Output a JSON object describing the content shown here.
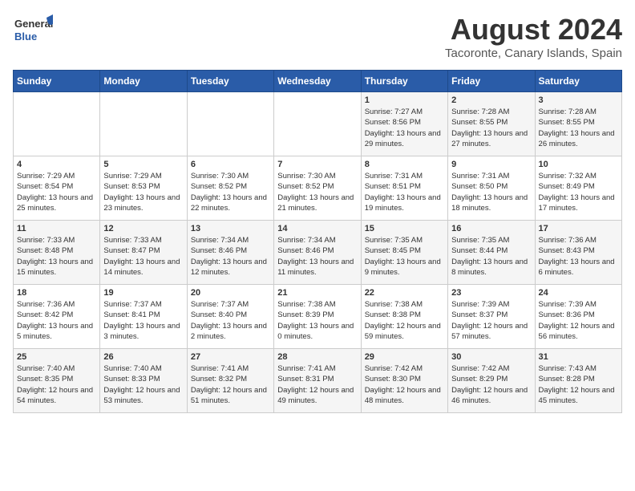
{
  "logo": {
    "general": "General",
    "blue": "Blue"
  },
  "title": "August 2024",
  "subtitle": "Tacoronte, Canary Islands, Spain",
  "days_of_week": [
    "Sunday",
    "Monday",
    "Tuesday",
    "Wednesday",
    "Thursday",
    "Friday",
    "Saturday"
  ],
  "weeks": [
    [
      {
        "day": "",
        "detail": ""
      },
      {
        "day": "",
        "detail": ""
      },
      {
        "day": "",
        "detail": ""
      },
      {
        "day": "",
        "detail": ""
      },
      {
        "day": "1",
        "detail": "Sunrise: 7:27 AM\nSunset: 8:56 PM\nDaylight: 13 hours\nand 29 minutes."
      },
      {
        "day": "2",
        "detail": "Sunrise: 7:28 AM\nSunset: 8:55 PM\nDaylight: 13 hours\nand 27 minutes."
      },
      {
        "day": "3",
        "detail": "Sunrise: 7:28 AM\nSunset: 8:55 PM\nDaylight: 13 hours\nand 26 minutes."
      }
    ],
    [
      {
        "day": "4",
        "detail": "Sunrise: 7:29 AM\nSunset: 8:54 PM\nDaylight: 13 hours\nand 25 minutes."
      },
      {
        "day": "5",
        "detail": "Sunrise: 7:29 AM\nSunset: 8:53 PM\nDaylight: 13 hours\nand 23 minutes."
      },
      {
        "day": "6",
        "detail": "Sunrise: 7:30 AM\nSunset: 8:52 PM\nDaylight: 13 hours\nand 22 minutes."
      },
      {
        "day": "7",
        "detail": "Sunrise: 7:30 AM\nSunset: 8:52 PM\nDaylight: 13 hours\nand 21 minutes."
      },
      {
        "day": "8",
        "detail": "Sunrise: 7:31 AM\nSunset: 8:51 PM\nDaylight: 13 hours\nand 19 minutes."
      },
      {
        "day": "9",
        "detail": "Sunrise: 7:31 AM\nSunset: 8:50 PM\nDaylight: 13 hours\nand 18 minutes."
      },
      {
        "day": "10",
        "detail": "Sunrise: 7:32 AM\nSunset: 8:49 PM\nDaylight: 13 hours\nand 17 minutes."
      }
    ],
    [
      {
        "day": "11",
        "detail": "Sunrise: 7:33 AM\nSunset: 8:48 PM\nDaylight: 13 hours\nand 15 minutes."
      },
      {
        "day": "12",
        "detail": "Sunrise: 7:33 AM\nSunset: 8:47 PM\nDaylight: 13 hours\nand 14 minutes."
      },
      {
        "day": "13",
        "detail": "Sunrise: 7:34 AM\nSunset: 8:46 PM\nDaylight: 13 hours\nand 12 minutes."
      },
      {
        "day": "14",
        "detail": "Sunrise: 7:34 AM\nSunset: 8:46 PM\nDaylight: 13 hours\nand 11 minutes."
      },
      {
        "day": "15",
        "detail": "Sunrise: 7:35 AM\nSunset: 8:45 PM\nDaylight: 13 hours\nand 9 minutes."
      },
      {
        "day": "16",
        "detail": "Sunrise: 7:35 AM\nSunset: 8:44 PM\nDaylight: 13 hours\nand 8 minutes."
      },
      {
        "day": "17",
        "detail": "Sunrise: 7:36 AM\nSunset: 8:43 PM\nDaylight: 13 hours\nand 6 minutes."
      }
    ],
    [
      {
        "day": "18",
        "detail": "Sunrise: 7:36 AM\nSunset: 8:42 PM\nDaylight: 13 hours\nand 5 minutes."
      },
      {
        "day": "19",
        "detail": "Sunrise: 7:37 AM\nSunset: 8:41 PM\nDaylight: 13 hours\nand 3 minutes."
      },
      {
        "day": "20",
        "detail": "Sunrise: 7:37 AM\nSunset: 8:40 PM\nDaylight: 13 hours\nand 2 minutes."
      },
      {
        "day": "21",
        "detail": "Sunrise: 7:38 AM\nSunset: 8:39 PM\nDaylight: 13 hours\nand 0 minutes."
      },
      {
        "day": "22",
        "detail": "Sunrise: 7:38 AM\nSunset: 8:38 PM\nDaylight: 12 hours\nand 59 minutes."
      },
      {
        "day": "23",
        "detail": "Sunrise: 7:39 AM\nSunset: 8:37 PM\nDaylight: 12 hours\nand 57 minutes."
      },
      {
        "day": "24",
        "detail": "Sunrise: 7:39 AM\nSunset: 8:36 PM\nDaylight: 12 hours\nand 56 minutes."
      }
    ],
    [
      {
        "day": "25",
        "detail": "Sunrise: 7:40 AM\nSunset: 8:35 PM\nDaylight: 12 hours\nand 54 minutes."
      },
      {
        "day": "26",
        "detail": "Sunrise: 7:40 AM\nSunset: 8:33 PM\nDaylight: 12 hours\nand 53 minutes."
      },
      {
        "day": "27",
        "detail": "Sunrise: 7:41 AM\nSunset: 8:32 PM\nDaylight: 12 hours\nand 51 minutes."
      },
      {
        "day": "28",
        "detail": "Sunrise: 7:41 AM\nSunset: 8:31 PM\nDaylight: 12 hours\nand 49 minutes."
      },
      {
        "day": "29",
        "detail": "Sunrise: 7:42 AM\nSunset: 8:30 PM\nDaylight: 12 hours\nand 48 minutes."
      },
      {
        "day": "30",
        "detail": "Sunrise: 7:42 AM\nSunset: 8:29 PM\nDaylight: 12 hours\nand 46 minutes."
      },
      {
        "day": "31",
        "detail": "Sunrise: 7:43 AM\nSunset: 8:28 PM\nDaylight: 12 hours\nand 45 minutes."
      }
    ]
  ]
}
